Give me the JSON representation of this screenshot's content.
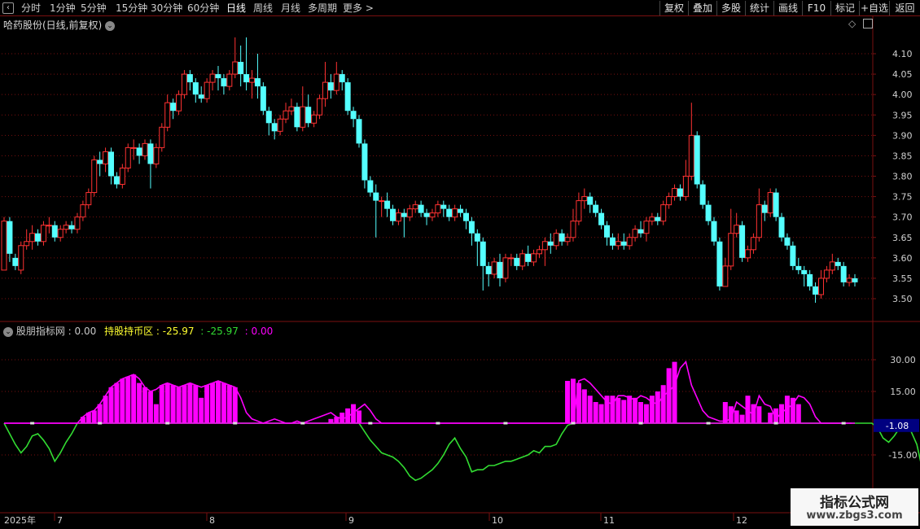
{
  "toolbar": {
    "periods": [
      "分时",
      "1分钟",
      "5分钟",
      "15分钟",
      "30分钟",
      "60分钟",
      "日线",
      "周线",
      "月线",
      "多周期",
      "更多 >"
    ],
    "active_period": "日线",
    "buttons": [
      "复权",
      "叠加",
      "多股",
      "统计",
      "画线",
      "F10",
      "标记",
      "+自选",
      "返回"
    ]
  },
  "main_chart": {
    "title": "哈药股份(日线,前复权)",
    "y_ticks": [
      "4.10",
      "4.05",
      "4.00",
      "3.95",
      "3.90",
      "3.85",
      "3.80",
      "3.75",
      "3.70",
      "3.65",
      "3.60",
      "3.55",
      "3.50"
    ],
    "ylim": [
      3.47,
      4.13
    ]
  },
  "indicator": {
    "name": "股朋指标网",
    "name_value": ": 0.00",
    "label2": "持股持币区",
    "value2": ": -25.97",
    "value3": ": -25.97",
    "value4": ": 0.00",
    "y_ticks": [
      "30.00",
      "15.00",
      "-15.00"
    ],
    "current_value": "-1.08",
    "ylim": [
      -28,
      42
    ]
  },
  "x_axis": {
    "year_label": "2025年",
    "month_labels": [
      "7",
      "8",
      "9",
      "10",
      "11",
      "12"
    ]
  },
  "colors": {
    "up": "#ff3232",
    "down": "#54ffff",
    "magenta": "#ff00ff",
    "green": "#32dc32",
    "grid": "#7a1010"
  },
  "watermark": {
    "title": "指标公式网",
    "url": "www.zbgs3.com"
  },
  "chart_data": {
    "type": "candlestick",
    "candles": [
      [
        3.57,
        3.69,
        3.57,
        3.7
      ],
      [
        3.69,
        3.61,
        3.59,
        3.7
      ],
      [
        3.6,
        3.58,
        3.57,
        3.61
      ],
      [
        3.57,
        3.63,
        3.56,
        3.64
      ],
      [
        3.63,
        3.64,
        3.62,
        3.67
      ],
      [
        3.64,
        3.66,
        3.62,
        3.68
      ],
      [
        3.66,
        3.64,
        3.63,
        3.67
      ],
      [
        3.64,
        3.68,
        3.63,
        3.69
      ],
      [
        3.68,
        3.68,
        3.66,
        3.7
      ],
      [
        3.68,
        3.65,
        3.64,
        3.69
      ],
      [
        3.65,
        3.67,
        3.64,
        3.68
      ],
      [
        3.67,
        3.68,
        3.66,
        3.69
      ],
      [
        3.68,
        3.67,
        3.66,
        3.69
      ],
      [
        3.67,
        3.7,
        3.66,
        3.71
      ],
      [
        3.7,
        3.73,
        3.69,
        3.74
      ],
      [
        3.73,
        3.76,
        3.72,
        3.77
      ],
      [
        3.76,
        3.84,
        3.75,
        3.85
      ],
      [
        3.84,
        3.83,
        3.8,
        3.86
      ],
      [
        3.83,
        3.86,
        3.81,
        3.87
      ],
      [
        3.86,
        3.8,
        3.78,
        3.87
      ],
      [
        3.8,
        3.78,
        3.77,
        3.81
      ],
      [
        3.78,
        3.82,
        3.77,
        3.83
      ],
      [
        3.82,
        3.87,
        3.81,
        3.88
      ],
      [
        3.87,
        3.87,
        3.84,
        3.89
      ],
      [
        3.87,
        3.85,
        3.83,
        3.88
      ],
      [
        3.85,
        3.88,
        3.84,
        3.89
      ],
      [
        3.88,
        3.83,
        3.77,
        3.89
      ],
      [
        3.83,
        3.87,
        3.82,
        3.88
      ],
      [
        3.87,
        3.92,
        3.86,
        3.93
      ],
      [
        3.92,
        3.98,
        3.91,
        4.0
      ],
      [
        3.98,
        3.96,
        3.94,
        3.99
      ],
      [
        3.96,
        4.0,
        3.95,
        4.01
      ],
      [
        4.0,
        4.05,
        3.99,
        4.06
      ],
      [
        4.05,
        4.03,
        4.01,
        4.06
      ],
      [
        4.03,
        4.0,
        3.98,
        4.04
      ],
      [
        4.0,
        3.99,
        3.98,
        4.02
      ],
      [
        3.99,
        4.03,
        3.98,
        4.04
      ],
      [
        4.03,
        4.05,
        4.01,
        4.06
      ],
      [
        4.05,
        4.04,
        4.01,
        4.07
      ],
      [
        4.04,
        4.02,
        4.0,
        4.05
      ],
      [
        4.02,
        4.05,
        4.01,
        4.06
      ],
      [
        4.05,
        4.08,
        4.04,
        4.14
      ],
      [
        4.08,
        4.05,
        4.02,
        4.12
      ],
      [
        4.05,
        4.03,
        4.01,
        4.14
      ],
      [
        4.03,
        4.04,
        3.99,
        4.06
      ],
      [
        4.04,
        4.02,
        3.99,
        4.1
      ],
      [
        4.02,
        3.96,
        3.95,
        4.03
      ],
      [
        3.96,
        3.93,
        3.9,
        3.97
      ],
      [
        3.93,
        3.91,
        3.89,
        3.94
      ],
      [
        3.91,
        3.94,
        3.9,
        3.95
      ],
      [
        3.94,
        3.96,
        3.93,
        3.98
      ],
      [
        3.96,
        3.97,
        3.95,
        3.99
      ],
      [
        3.97,
        3.92,
        3.91,
        3.98
      ],
      [
        3.92,
        3.97,
        3.91,
        4.02
      ],
      [
        3.97,
        3.93,
        3.92,
        4.0
      ],
      [
        3.93,
        3.95,
        3.92,
        3.96
      ],
      [
        3.95,
        3.99,
        3.94,
        4.0
      ],
      [
        3.99,
        4.03,
        3.97,
        4.08
      ],
      [
        4.03,
        4.01,
        3.99,
        4.05
      ],
      [
        4.01,
        4.05,
        4.0,
        4.08
      ],
      [
        4.05,
        4.03,
        4.01,
        4.06
      ],
      [
        4.03,
        3.96,
        3.95,
        4.04
      ],
      [
        3.96,
        3.94,
        3.92,
        3.97
      ],
      [
        3.94,
        3.88,
        3.87,
        3.95
      ],
      [
        3.88,
        3.79,
        3.77,
        3.89
      ],
      [
        3.79,
        3.76,
        3.75,
        3.8
      ],
      [
        3.76,
        3.74,
        3.65,
        3.78
      ],
      [
        3.74,
        3.74,
        3.7,
        3.75
      ],
      [
        3.74,
        3.72,
        3.7,
        3.76
      ],
      [
        3.72,
        3.69,
        3.68,
        3.73
      ],
      [
        3.69,
        3.71,
        3.68,
        3.72
      ],
      [
        3.71,
        3.7,
        3.65,
        3.72
      ],
      [
        3.7,
        3.72,
        3.69,
        3.73
      ],
      [
        3.72,
        3.73,
        3.71,
        3.74
      ],
      [
        3.73,
        3.71,
        3.7,
        3.74
      ],
      [
        3.71,
        3.7,
        3.68,
        3.72
      ],
      [
        3.7,
        3.71,
        3.69,
        3.72
      ],
      [
        3.71,
        3.73,
        3.7,
        3.74
      ],
      [
        3.73,
        3.72,
        3.7,
        3.74
      ],
      [
        3.72,
        3.7,
        3.69,
        3.73
      ],
      [
        3.7,
        3.72,
        3.69,
        3.73
      ],
      [
        3.72,
        3.71,
        3.7,
        3.73
      ],
      [
        3.71,
        3.69,
        3.67,
        3.72
      ],
      [
        3.69,
        3.66,
        3.63,
        3.7
      ],
      [
        3.66,
        3.64,
        3.58,
        3.67
      ],
      [
        3.64,
        3.58,
        3.52,
        3.65
      ],
      [
        3.58,
        3.56,
        3.53,
        3.59
      ],
      [
        3.56,
        3.59,
        3.55,
        3.6
      ],
      [
        3.59,
        3.55,
        3.53,
        3.61
      ],
      [
        3.55,
        3.6,
        3.54,
        3.61
      ],
      [
        3.6,
        3.6,
        3.58,
        3.61
      ],
      [
        3.6,
        3.58,
        3.57,
        3.61
      ],
      [
        3.58,
        3.61,
        3.57,
        3.62
      ],
      [
        3.61,
        3.59,
        3.58,
        3.63
      ],
      [
        3.59,
        3.61,
        3.58,
        3.62
      ],
      [
        3.61,
        3.62,
        3.6,
        3.63
      ],
      [
        3.62,
        3.64,
        3.58,
        3.65
      ],
      [
        3.64,
        3.63,
        3.61,
        3.66
      ],
      [
        3.63,
        3.66,
        3.62,
        3.67
      ],
      [
        3.66,
        3.64,
        3.63,
        3.67
      ],
      [
        3.64,
        3.65,
        3.63,
        3.66
      ],
      [
        3.65,
        3.69,
        3.64,
        3.72
      ],
      [
        3.69,
        3.74,
        3.68,
        3.76
      ],
      [
        3.74,
        3.75,
        3.72,
        3.77
      ],
      [
        3.75,
        3.73,
        3.71,
        3.76
      ],
      [
        3.73,
        3.71,
        3.7,
        3.74
      ],
      [
        3.71,
        3.68,
        3.67,
        3.72
      ],
      [
        3.68,
        3.65,
        3.63,
        3.69
      ],
      [
        3.65,
        3.63,
        3.62,
        3.66
      ],
      [
        3.63,
        3.64,
        3.62,
        3.66
      ],
      [
        3.64,
        3.63,
        3.62,
        3.66
      ],
      [
        3.63,
        3.65,
        3.62,
        3.66
      ],
      [
        3.65,
        3.67,
        3.64,
        3.68
      ],
      [
        3.67,
        3.66,
        3.65,
        3.69
      ],
      [
        3.66,
        3.69,
        3.64,
        3.7
      ],
      [
        3.69,
        3.7,
        3.68,
        3.71
      ],
      [
        3.7,
        3.69,
        3.68,
        3.71
      ],
      [
        3.69,
        3.73,
        3.68,
        3.74
      ],
      [
        3.73,
        3.75,
        3.72,
        3.76
      ],
      [
        3.75,
        3.77,
        3.74,
        3.78
      ],
      [
        3.77,
        3.75,
        3.74,
        3.78
      ],
      [
        3.75,
        3.8,
        3.74,
        3.84
      ],
      [
        3.8,
        3.9,
        3.79,
        3.98
      ],
      [
        3.9,
        3.78,
        3.77,
        3.91
      ],
      [
        3.78,
        3.73,
        3.72,
        3.79
      ],
      [
        3.73,
        3.69,
        3.68,
        3.74
      ],
      [
        3.69,
        3.64,
        3.63,
        3.7
      ],
      [
        3.64,
        3.53,
        3.52,
        3.65
      ],
      [
        3.53,
        3.58,
        3.53,
        3.6
      ],
      [
        3.58,
        3.66,
        3.57,
        3.72
      ],
      [
        3.66,
        3.68,
        3.65,
        3.71
      ],
      [
        3.68,
        3.6,
        3.59,
        3.69
      ],
      [
        3.6,
        3.62,
        3.59,
        3.63
      ],
      [
        3.62,
        3.65,
        3.61,
        3.66
      ],
      [
        3.65,
        3.73,
        3.64,
        3.77
      ],
      [
        3.73,
        3.71,
        3.69,
        3.74
      ],
      [
        3.71,
        3.76,
        3.7,
        3.77
      ],
      [
        3.76,
        3.7,
        3.69,
        3.77
      ],
      [
        3.7,
        3.65,
        3.64,
        3.71
      ],
      [
        3.65,
        3.63,
        3.62,
        3.66
      ],
      [
        3.63,
        3.58,
        3.57,
        3.64
      ],
      [
        3.58,
        3.57,
        3.56,
        3.6
      ],
      [
        3.57,
        3.56,
        3.53,
        3.58
      ],
      [
        3.56,
        3.53,
        3.52,
        3.57
      ],
      [
        3.53,
        3.51,
        3.49,
        3.54
      ],
      [
        3.51,
        3.55,
        3.5,
        3.57
      ],
      [
        3.55,
        3.57,
        3.54,
        3.58
      ],
      [
        3.57,
        3.59,
        3.56,
        3.61
      ],
      [
        3.59,
        3.58,
        3.57,
        3.6
      ],
      [
        3.58,
        3.54,
        3.53,
        3.59
      ],
      [
        3.54,
        3.55,
        3.53,
        3.56
      ],
      [
        3.55,
        3.54,
        3.53,
        3.56
      ]
    ],
    "indicator_bars": [
      0,
      0,
      0,
      0,
      0,
      0,
      0,
      0,
      0,
      0,
      0,
      0,
      0,
      0,
      3,
      5,
      6,
      9,
      13,
      17,
      19,
      21,
      22,
      23,
      19,
      17,
      15,
      9,
      18,
      19,
      18,
      17,
      18,
      19,
      18,
      12,
      18,
      19,
      20,
      19,
      18,
      17,
      0,
      0,
      0,
      0,
      0,
      0,
      0,
      0,
      0,
      0,
      0,
      0,
      0,
      0,
      0,
      0,
      2,
      3,
      5,
      7,
      9,
      6,
      0,
      0,
      0,
      0,
      0,
      0,
      0,
      0,
      0,
      0,
      0,
      0,
      0,
      0,
      0,
      0,
      0,
      0,
      0,
      0,
      0,
      0,
      0,
      0,
      0,
      0,
      0,
      0,
      0,
      0,
      0,
      0,
      0,
      0,
      0,
      0,
      20,
      21,
      19,
      16,
      13,
      10,
      9,
      13,
      13,
      12,
      11,
      13,
      12,
      10,
      9,
      13,
      15,
      18,
      26,
      29,
      0,
      0,
      0,
      0,
      0,
      0,
      0,
      0,
      10,
      8,
      6,
      4,
      13,
      9,
      8,
      0,
      5,
      7,
      9,
      13,
      12,
      9,
      0,
      0,
      0,
      0,
      0,
      0,
      0,
      0
    ],
    "magenta_line": [
      0,
      0,
      0,
      0,
      0,
      0,
      0,
      0,
      0,
      0,
      0,
      0,
      0,
      0,
      3,
      5,
      6,
      9,
      13,
      17,
      19,
      21,
      22,
      23,
      21,
      17,
      15,
      16,
      18,
      19,
      18,
      17,
      18,
      19,
      18,
      17,
      18,
      19,
      20,
      19,
      18,
      17,
      12,
      5,
      2,
      1,
      0,
      1,
      2,
      1,
      0,
      0,
      1,
      0,
      1,
      2,
      3,
      4,
      5,
      3,
      2,
      3,
      5,
      7,
      9,
      6,
      2,
      0,
      0,
      0,
      0,
      0,
      0,
      0,
      0,
      0,
      0,
      0,
      0,
      0,
      0,
      0,
      0,
      0,
      0,
      0,
      0,
      0,
      0,
      0,
      0,
      0,
      0,
      0,
      0,
      0,
      0,
      0,
      0,
      0,
      0,
      0,
      20,
      21,
      19,
      16,
      13,
      10,
      9,
      13,
      13,
      12,
      11,
      13,
      12,
      10,
      9,
      13,
      15,
      18,
      26,
      29,
      18,
      12,
      6,
      3,
      2,
      1,
      1,
      2,
      10,
      8,
      6,
      4,
      13,
      9,
      8,
      2,
      5,
      7,
      9,
      13,
      12,
      9,
      3,
      0,
      0,
      0,
      0,
      0,
      0,
      0
    ],
    "green_line": [
      0,
      -5,
      -10,
      -14,
      -11,
      -6,
      -5,
      -8,
      -12,
      -18,
      -14,
      -9,
      -5,
      0,
      0,
      0,
      0,
      0,
      0,
      0,
      0,
      0,
      0,
      0,
      0,
      0,
      0,
      0,
      0,
      0,
      0,
      0,
      0,
      0,
      0,
      0,
      0,
      0,
      0,
      0,
      0,
      0,
      0,
      0,
      0,
      0,
      0,
      0,
      0,
      0,
      0,
      0,
      0,
      0,
      0,
      0,
      0,
      0,
      0,
      0,
      0,
      0,
      0,
      0,
      -4,
      -8,
      -11,
      -14,
      -15,
      -16,
      -18,
      -21,
      -25,
      -27,
      -26,
      -24,
      -22,
      -19,
      -15,
      -10,
      -7,
      -12,
      -16,
      -23,
      -22,
      -22,
      -20,
      -20,
      -19,
      -18,
      -18,
      -17,
      -16,
      -15,
      -13,
      -14,
      -11,
      -11,
      -10,
      -5,
      -1,
      0,
      0,
      0,
      0,
      0,
      0,
      0,
      0,
      0,
      0,
      0,
      0,
      0,
      0,
      0,
      0,
      0,
      0,
      0,
      0,
      0,
      0,
      0,
      0,
      0,
      0,
      0,
      0,
      0,
      0,
      0,
      0,
      0,
      0,
      0,
      0,
      0,
      0,
      0,
      0,
      0,
      0,
      0,
      0,
      0,
      0,
      0,
      0,
      0,
      0,
      0,
      0,
      0,
      0,
      -2,
      -7,
      -9,
      -6,
      -2,
      0,
      -4,
      -10,
      -22,
      -25,
      -26
    ]
  }
}
